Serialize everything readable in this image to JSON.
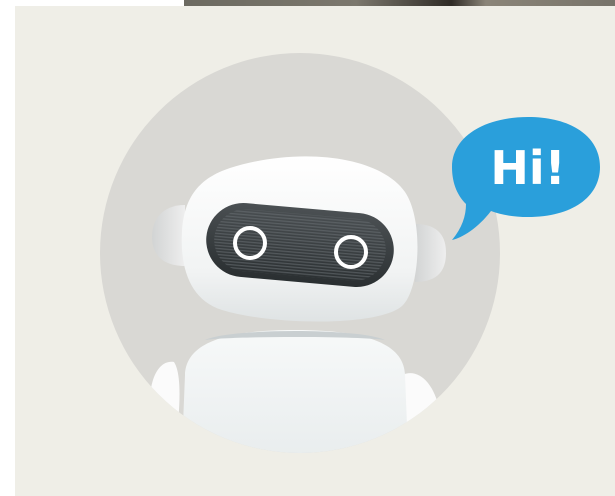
{
  "greeting": {
    "text": "Hi!",
    "bubble_color": "#2a9fdb"
  },
  "illustration": {
    "subject": "robot-mascot",
    "background_color": "#efeee7",
    "circle_color": "#d9d8d4"
  }
}
